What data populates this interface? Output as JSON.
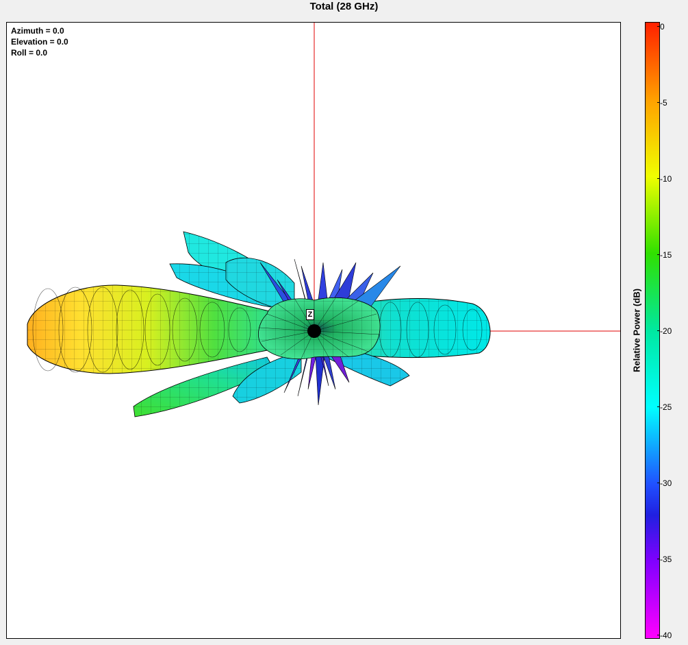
{
  "window": {
    "title": "Total (28 GHz)"
  },
  "orientation": {
    "azimuth": "Azimuth = 0.0",
    "elevation": "Elevation = 0.0",
    "roll": "Roll = 0.0"
  },
  "axis_label": "Z",
  "colorbar": {
    "label": "Relative Power  (dB)",
    "ticks": [
      "0",
      "-5",
      "-10",
      "-15",
      "-20",
      "-25",
      "-30",
      "-35",
      "-40"
    ],
    "range_db": [
      -40,
      0
    ],
    "colors": {
      "0": "#ff2000",
      "-5": "#ffa000",
      "-10": "#f0ff00",
      "-15": "#30e000",
      "-20": "#00e8a0",
      "-25": "#00ffff",
      "-30": "#2050ff",
      "-32": "#2020e0",
      "-35": "#8000ff",
      "-40": "#ff00ff"
    }
  },
  "pattern": {
    "lobes": [
      {
        "name": "main-lobe-left",
        "color": "#ffd22a",
        "color_outer": "#e8f020",
        "color_inner": "#30e050"
      },
      {
        "name": "lobe-right",
        "color": "#00ecd8",
        "color_inner": "#30e8b0"
      },
      {
        "name": "side-lobe-lower-left",
        "color": "#38ea30"
      },
      {
        "name": "side-lobe-upper-left",
        "color": "#20e8e0"
      },
      {
        "name": "side-lobe-upper",
        "color": "#20d8e0"
      },
      {
        "name": "side-lobe-lower-right",
        "color": "#1ac8e8"
      },
      {
        "name": "central-disc",
        "color": "#28d890"
      },
      {
        "name": "spikes",
        "color": "#3040e0"
      }
    ],
    "crosshair_color": "#e00000"
  }
}
